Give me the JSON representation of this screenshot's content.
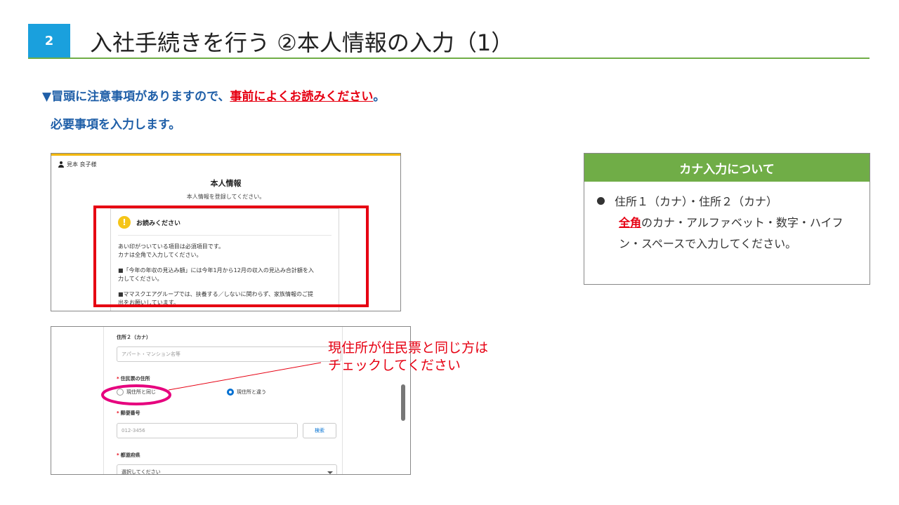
{
  "header": {
    "step_number": "2",
    "title": "入社手続きを行う ②本人情報の入力（1）"
  },
  "intro": {
    "line1_prefix": "▼冒頭に注意事項がありますので、",
    "line1_highlight": "事前によくお読みください",
    "line1_suffix": "。",
    "line2": "必要事項を入力します。"
  },
  "screenshot1": {
    "user_name": "見本 良子様",
    "form_title": "本人情報",
    "form_subtitle": "本人情報を登録してください。",
    "notice_title": "お読みください",
    "notice_lines": [
      "あい印がついている項目は必須項目です。",
      "カナは全角で入力してください。",
      "■「今年の年収の見込み額」には今年1月から12月の収入の見込み合計額を入",
      "力してください。",
      "■ママスクエアグループでは、扶養する／しないに関わらず、家族情報のご提",
      "出をお願いしています。"
    ]
  },
  "screenshot2": {
    "address2_kana_label": "住所２（カナ）",
    "address2_kana_placeholder": "アパート・マンション名等",
    "resident_address_label": "住民票の住所",
    "radio_same": "現住所と同じ",
    "radio_different": "現住所と違う",
    "postal_code_label": "郵便番号",
    "postal_code_placeholder": "012-3456",
    "search_button": "検索",
    "prefecture_label": "都道府県",
    "prefecture_placeholder": "選択してください"
  },
  "callout": {
    "line1": "現住所が住民票と同じ方は",
    "line2": "チェックしてください"
  },
  "kana_panel": {
    "heading": "カナ入力について",
    "line1": "住所１（カナ）・住所２（カナ）",
    "line2_highlight": "全角",
    "line2_rest": "のカナ・アルファベット・数字・ハイフ",
    "line3": "ン・スペースで入力してください。"
  },
  "colors": {
    "step_badge": "#1aa0dd",
    "title_rule": "#70ad47",
    "intro_text": "#1f5fa8",
    "highlight": "#e60012",
    "callout_ellipse": "#e6007e"
  }
}
